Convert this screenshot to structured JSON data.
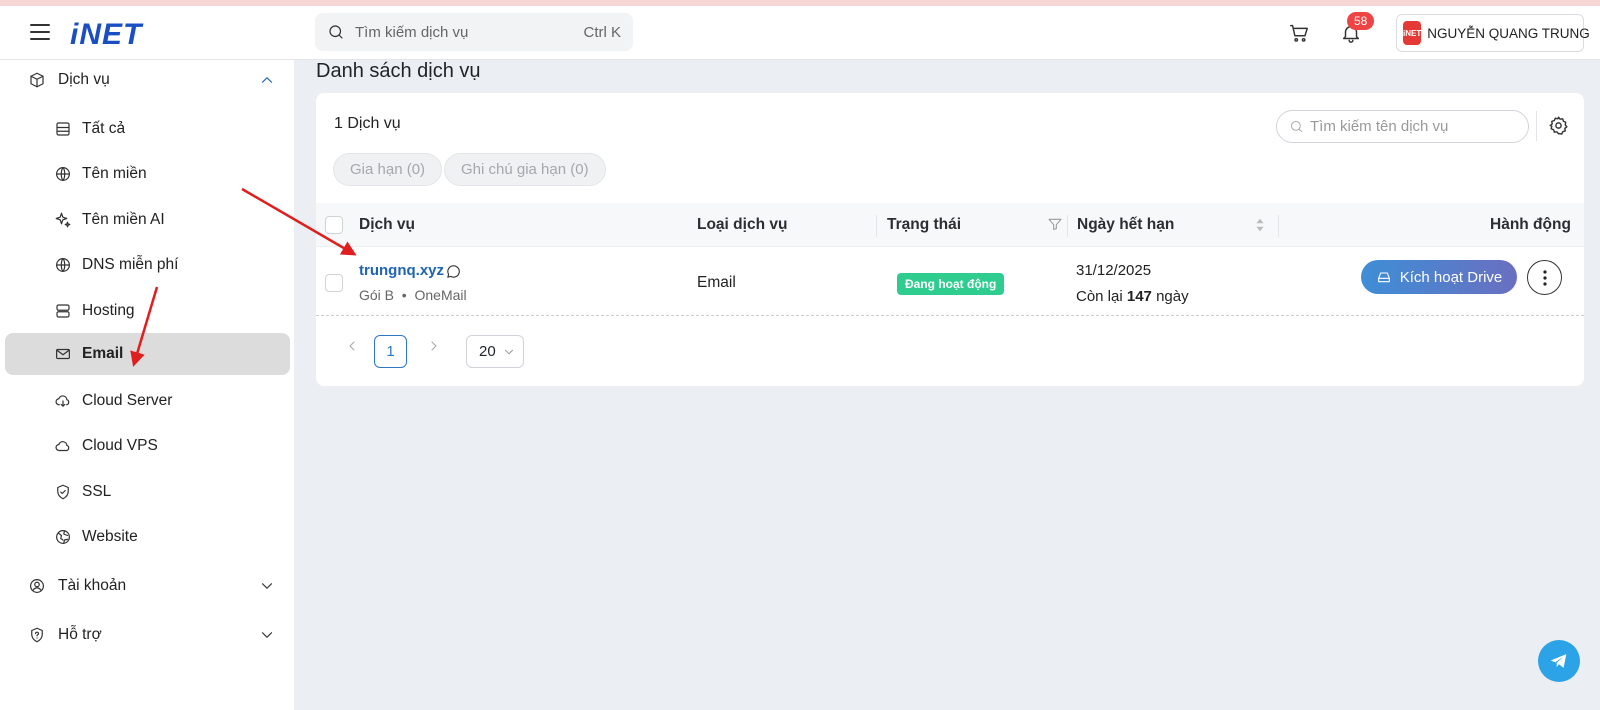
{
  "header": {
    "logo": "iNET",
    "search_placeholder": "Tìm kiếm dịch vụ",
    "search_shortcut": "Ctrl K",
    "notification_count": "58",
    "user_avatar": "iNET",
    "user_name": "NGUYỄN QUANG TRUNG"
  },
  "sidebar": {
    "group_services": "Dịch vụ",
    "items": [
      "Tất cả",
      "Tên miền",
      "Tên miền AI",
      "DNS miễn phí",
      "Hosting",
      "Email",
      "Cloud Server",
      "Cloud VPS",
      "SSL",
      "Website"
    ],
    "active_item": "Email",
    "group_account": "Tài khoản",
    "group_support": "Hỗ trợ"
  },
  "main": {
    "title": "Danh sách dịch vụ",
    "count_label": "1 Dịch vụ",
    "service_search_placeholder": "Tìm kiếm tên dịch vụ",
    "filters": [
      "Gia hạn (0)",
      "Ghi chú gia hạn (0)"
    ],
    "columns": [
      "Dịch vụ",
      "Loại dịch vụ",
      "Trạng thái",
      "Ngày hết hạn",
      "Hành động"
    ],
    "rows": [
      {
        "name": "trungnq.xyz",
        "plan": "Gói B",
        "product": "OneMail",
        "type": "Email",
        "status": "Đang hoạt động",
        "expiry": "31/12/2025",
        "remaining_prefix": "Còn lại",
        "remaining_days": "147",
        "remaining_suffix": "ngày",
        "action": "Kích hoạt Drive"
      }
    ],
    "pagination": {
      "current_page": "1",
      "page_size": "20"
    }
  },
  "colors": {
    "accent": "#1d64b5",
    "status_active": "#2ecc8f",
    "active_nav_bg": "#dcdcdc",
    "annotation_arrow": "#e01e1e"
  }
}
